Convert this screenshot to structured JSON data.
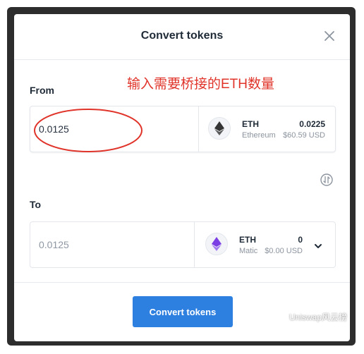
{
  "modal": {
    "title": "Convert tokens"
  },
  "annotation": "输入需要桥接的ETH数量",
  "from": {
    "label": "From",
    "amount": "0.0125",
    "token_symbol": "ETH",
    "token_chain": "Ethereum",
    "balance": "0.0225",
    "balance_usd": "$60.59 USD",
    "icon": "eth-icon"
  },
  "to": {
    "label": "To",
    "amount": "0.0125",
    "token_symbol": "ETH",
    "token_chain": "Matic",
    "balance": "0",
    "balance_usd": "$0.00 USD",
    "icon": "eth-purple-icon"
  },
  "actions": {
    "convert_label": "Convert tokens"
  },
  "watermark": "Uniswap风云榜",
  "colors": {
    "primary": "#2d7fe0",
    "annotation": "#e0342a",
    "eth_dark": "#343434",
    "eth_purple": "#7b3fe4"
  }
}
